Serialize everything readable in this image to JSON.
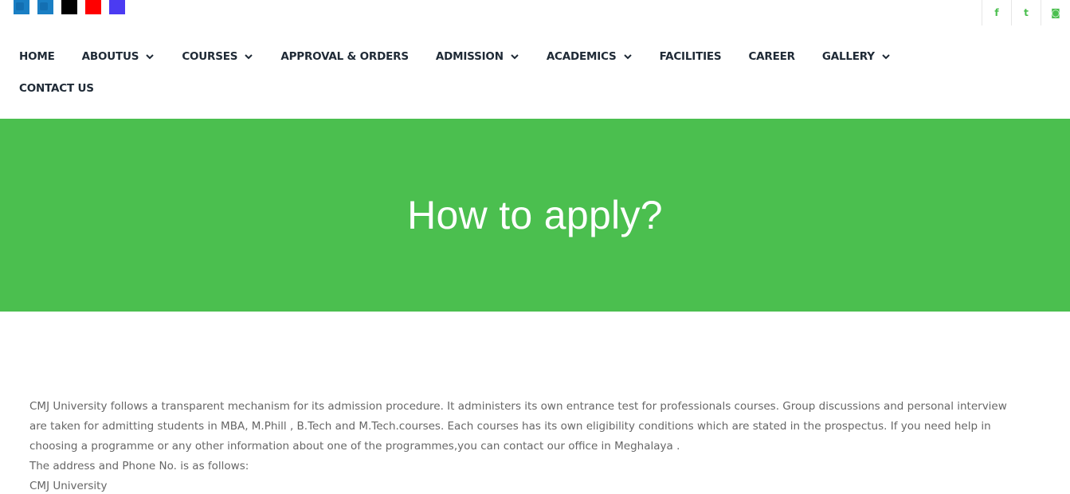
{
  "top_icons": [
    {
      "name": "linkedin-square",
      "color": "#1a7fc4"
    },
    {
      "name": "linkedin-square",
      "color": "#1a7fc4"
    },
    {
      "name": "black-square",
      "color": "#000000"
    },
    {
      "name": "youtube-square",
      "color": "#ff0000"
    },
    {
      "name": "purple-square",
      "color": "#4b3bf2"
    }
  ],
  "social": {
    "color": "#4bbf4f",
    "items": [
      {
        "name": "facebook-icon",
        "glyph": "f"
      },
      {
        "name": "twitter-icon",
        "glyph": "t"
      },
      {
        "name": "instagram-icon",
        "glyph": "◙"
      }
    ]
  },
  "nav": {
    "items": [
      {
        "label": "HOME",
        "dropdown": false
      },
      {
        "label": "ABOUTUS",
        "dropdown": true
      },
      {
        "label": "COURSES",
        "dropdown": true
      },
      {
        "label": "APPROVAL & ORDERS",
        "dropdown": false
      },
      {
        "label": "ADMISSION",
        "dropdown": true
      },
      {
        "label": "ACADEMICS",
        "dropdown": true
      },
      {
        "label": "FACILITIES",
        "dropdown": false
      },
      {
        "label": "CAREER",
        "dropdown": false
      },
      {
        "label": "GALLERY",
        "dropdown": true
      },
      {
        "label": "CONTACT US",
        "dropdown": false
      }
    ]
  },
  "hero": {
    "title": "How to apply?",
    "bg_color": "#4bbf4f"
  },
  "content": {
    "paragraph": "CMJ University follows a transparent mechanism for its admission procedure. It administers its own entrance test for professionals courses. Group discussions and personal interview are taken for admitting students in MBA, M.Phill , B.Tech and M.Tech.courses. Each courses has its own eligibility conditions which are stated in the prospectus. If you need help in choosing a programme or any other information about one of the programmes,you can contact our office in Meghalaya .",
    "address_line": "The address and Phone No. is as follows:",
    "org_line": "CMJ University"
  }
}
